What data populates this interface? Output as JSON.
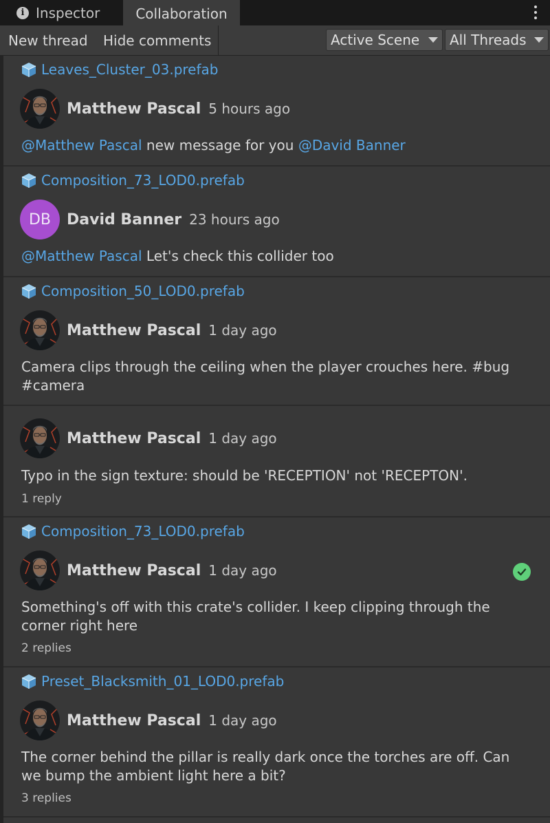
{
  "tabs": {
    "inspector_icon": "info-icon",
    "inspector_label": "Inspector",
    "collaboration_label": "Collaboration"
  },
  "toolbar": {
    "new_thread_label": "New thread",
    "hide_comments_label": "Hide comments",
    "scene_filter_value": "Active Scene",
    "thread_filter_value": "All Threads"
  },
  "colors": {
    "link": "#58a7e6",
    "avatar_db": "#a74ed0",
    "resolved": "#5fd07a",
    "panel_bg": "#383838"
  },
  "threads": [
    {
      "asset": "Leaves_Cluster_03.prefab",
      "author": "Matthew Pascal",
      "time": "5 hours ago",
      "message_mention_1": "@Matthew Pascal",
      "message_text": " new message for you ",
      "message_mention_2": "@David Banner"
    },
    {
      "asset": "Composition_73_LOD0.prefab",
      "author_initials": "DB",
      "author": "David Banner",
      "time": "23 hours ago",
      "message_mention_1": "@Matthew Pascal",
      "message_text": " Let's check this collider too"
    },
    {
      "asset": "Composition_50_LOD0.prefab",
      "author": "Matthew Pascal",
      "time": "1 day ago",
      "message": "Camera clips through the ceiling when the player crouches here. #bug #camera"
    },
    {
      "author": "Matthew Pascal",
      "time": "1 day ago",
      "message": "Typo in the sign texture: should be 'RECEPTION' not 'RECEPTON'.",
      "replies": "1 reply"
    },
    {
      "asset": "Composition_73_LOD0.prefab",
      "author": "Matthew Pascal",
      "time": "1 day ago",
      "resolved_icon": "check-circle-icon",
      "message": "Something's off with this crate's collider. I keep clipping through the corner right here",
      "replies": "2 replies"
    },
    {
      "asset": "Preset_Blacksmith_01_LOD0.prefab",
      "author": "Matthew Pascal",
      "time": "1 day ago",
      "message": "The corner behind the pillar is really dark once the torches are off. Can we bump the ambient light here a bit?",
      "replies": "3 replies"
    }
  ]
}
